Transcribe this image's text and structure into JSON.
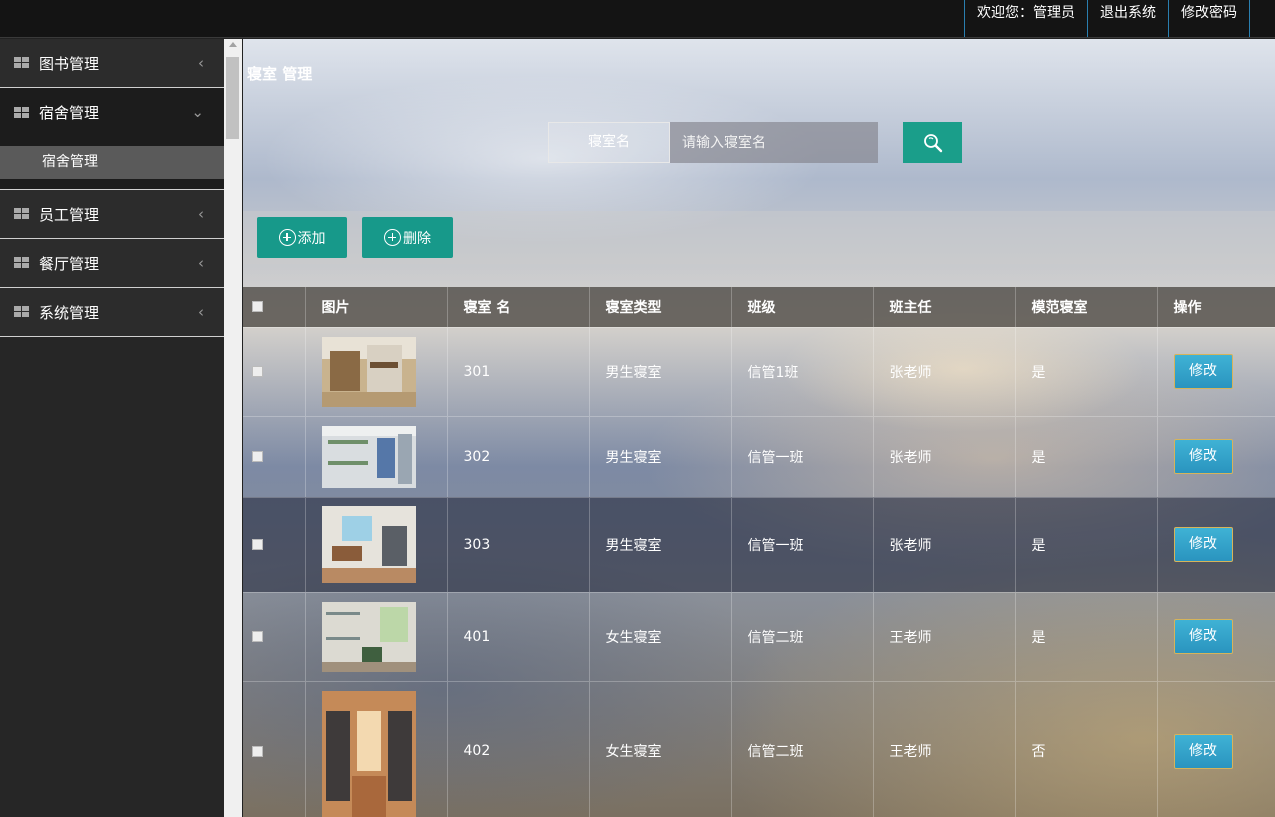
{
  "topbar": {
    "welcome": "欢迎您：管理员",
    "logout": "退出系统",
    "change_password": "修改密码"
  },
  "sidebar": {
    "items": [
      {
        "label": "图书管理",
        "arrow": "‹"
      },
      {
        "label": "宿舍管理",
        "arrow": "⌄",
        "sub": "宿舍管理"
      },
      {
        "label": "员工管理",
        "arrow": "‹"
      },
      {
        "label": "餐厅管理",
        "arrow": "‹"
      },
      {
        "label": "系统管理",
        "arrow": "‹"
      }
    ]
  },
  "main": {
    "title": "寝室 管理",
    "search": {
      "label": "寝室名",
      "placeholder": "请输入寝室名"
    },
    "toolbar": {
      "add": "添加",
      "delete": "删除"
    },
    "table": {
      "headers": [
        "图片",
        "寝室 名",
        "寝室类型",
        "班级",
        "班主任",
        "模范寝室",
        "操作"
      ],
      "edit_label": "修改",
      "rows": [
        {
          "name": "301",
          "type": "男生寝室",
          "class": "信管1班",
          "teacher": "张老师",
          "model": "是"
        },
        {
          "name": "302",
          "type": "男生寝室",
          "class": "信管一班",
          "teacher": "张老师",
          "model": "是"
        },
        {
          "name": "303",
          "type": "男生寝室",
          "class": "信管一班",
          "teacher": "张老师",
          "model": "是"
        },
        {
          "name": "401",
          "type": "女生寝室",
          "class": "信管二班",
          "teacher": "王老师",
          "model": "是"
        },
        {
          "name": "402",
          "type": "女生寝室",
          "class": "信管二班",
          "teacher": "王老师",
          "model": "否"
        }
      ]
    }
  },
  "colors": {
    "accent": "#1a9e8a",
    "edit_button": "#3fb2d5"
  }
}
